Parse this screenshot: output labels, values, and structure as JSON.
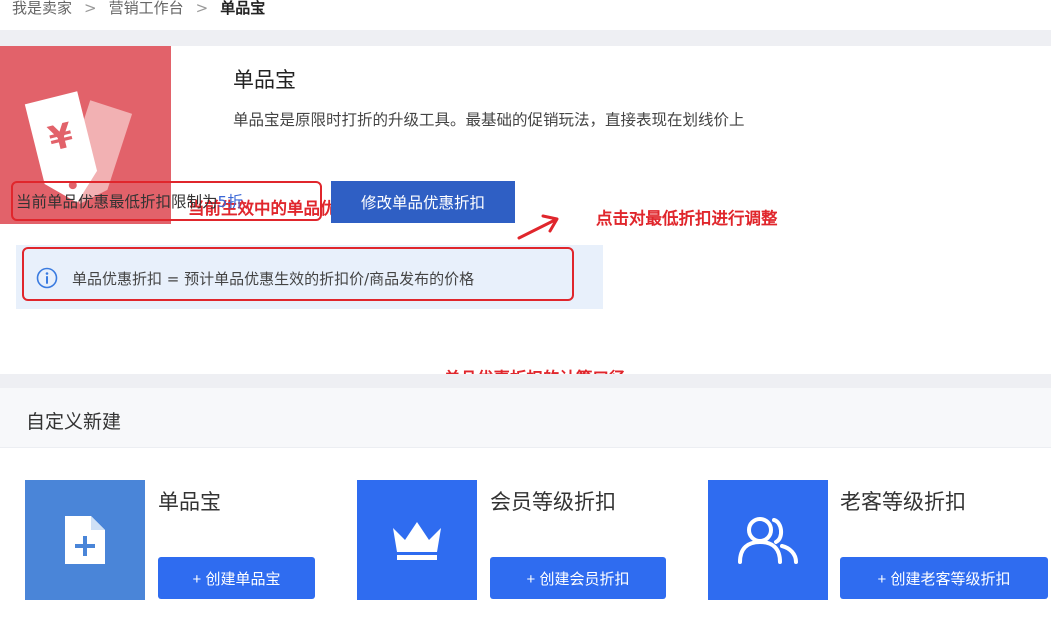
{
  "breadcrumb": {
    "items": [
      "我是卖家",
      "营销工作台",
      "单品宝"
    ],
    "separator": ">"
  },
  "hero": {
    "title": "单品宝",
    "description": "单品宝是原限时打折的升级工具。最基础的促销玩法，直接表现在划线价上",
    "icon": "yen-tag-icon",
    "tile_color": "#e2626a",
    "limit_label": "当前单品优惠最低折扣限制为",
    "limit_value": "5折",
    "edit_button": "修改单品优惠折扣",
    "info_text": "单品优惠折扣 = 预计单品优惠生效的折扣价/商品发布的价格"
  },
  "annotations": {
    "current_discount": "当前生效中的单品优惠折扣",
    "adjust_hint": "点击对最低折扣进行调整",
    "calc_basis": "单品优惠折扣的计算口径",
    "color": "#e0262c"
  },
  "custom": {
    "section_title": "自定义新建",
    "cards": [
      {
        "title": "单品宝",
        "button": "+ 创建单品宝",
        "icon": "document-add-icon",
        "color": "#4a85d8"
      },
      {
        "title": "会员等级折扣",
        "button": "+ 创建会员折扣",
        "icon": "crown-icon",
        "color": "#2f6cf0"
      },
      {
        "title": "老客等级折扣",
        "button": "+ 创建老客等级折扣",
        "icon": "users-icon",
        "color": "#2f6cf0"
      }
    ]
  }
}
